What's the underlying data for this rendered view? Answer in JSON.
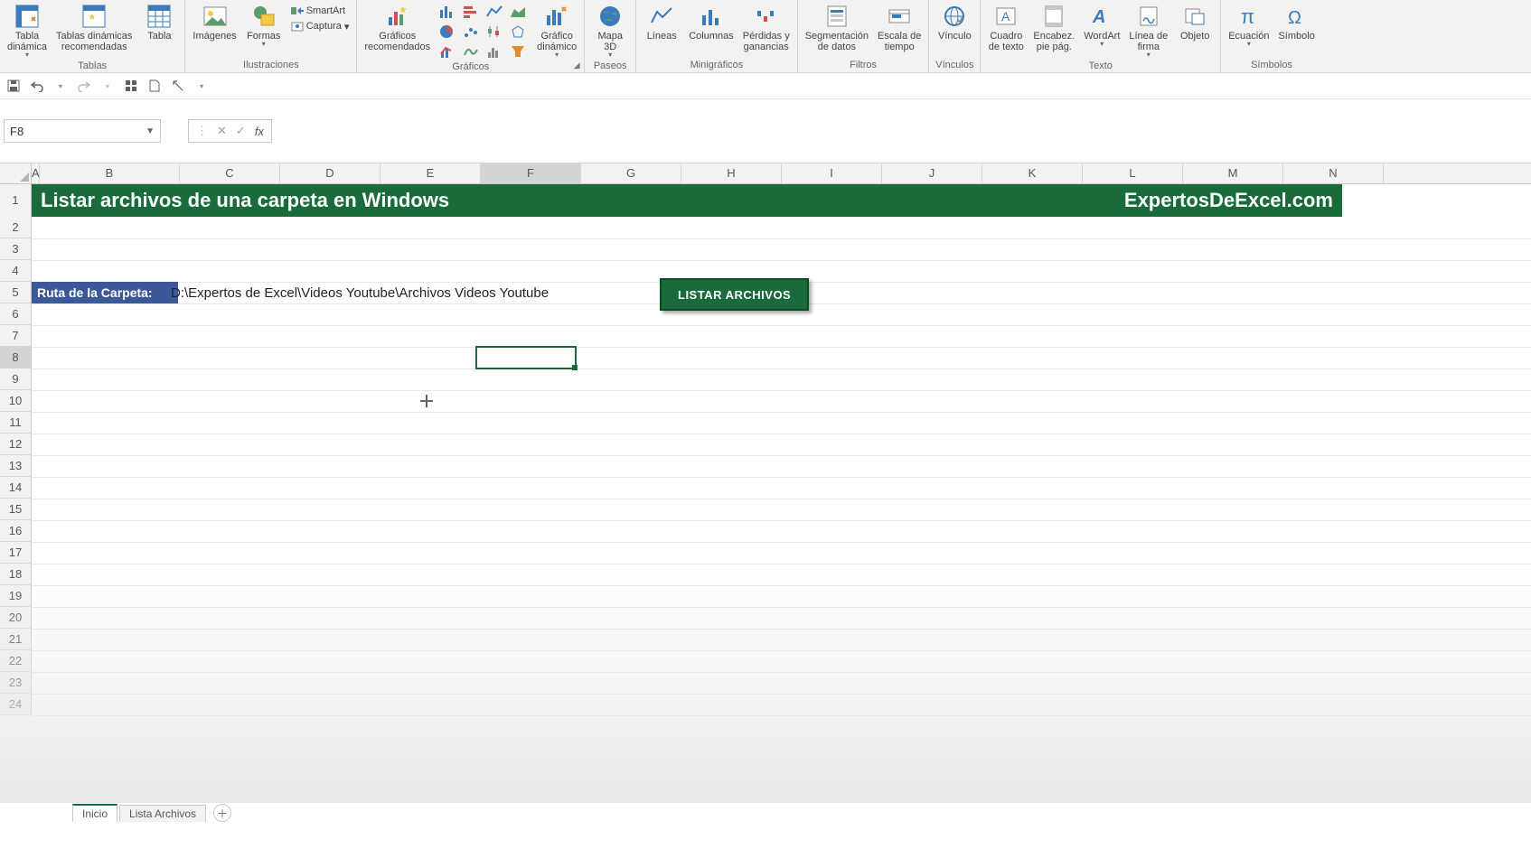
{
  "ribbon": {
    "groups": {
      "tablas": {
        "label": "Tablas",
        "pivot": "Tabla\ndinámica",
        "pivot_rec": "Tablas dinámicas\nrecomendadas",
        "table": "Tabla"
      },
      "ilustraciones": {
        "label": "Ilustraciones",
        "images": "Imágenes",
        "shapes": "Formas",
        "smartart": "SmartArt",
        "capture": "Captura"
      },
      "graficos": {
        "label": "Gráficos",
        "rec": "Gráficos\nrecomendados",
        "dynamic": "Gráfico\ndinámico"
      },
      "paseos": {
        "label": "Paseos",
        "map3d": "Mapa\n3D"
      },
      "mini": {
        "label": "Minigráficos",
        "lines": "Líneas",
        "cols": "Columnas",
        "winloss": "Pérdidas y\nganancias"
      },
      "filtros": {
        "label": "Filtros",
        "slicer": "Segmentación\nde datos",
        "timeline": "Escala de\ntiempo"
      },
      "vinculos": {
        "label": "Vínculos",
        "link": "Vínculo"
      },
      "texto": {
        "label": "Texto",
        "textbox": "Cuadro\nde texto",
        "header": "Encabez.\npie pág.",
        "wordart": "WordArt",
        "sig": "Línea de\nfirma",
        "obj": "Objeto"
      },
      "simbolos": {
        "label": "Símbolos",
        "eq": "Ecuación",
        "sym": "Símbolo"
      }
    }
  },
  "name_box": "F8",
  "formula_bar": "",
  "columns": [
    "A",
    "B",
    "C",
    "D",
    "E",
    "F",
    "G",
    "H",
    "I",
    "J",
    "K",
    "L",
    "M",
    "N"
  ],
  "col_widths": {
    "A": 8,
    "B": 154,
    "C": 110,
    "D": 110,
    "E": 110,
    "F": 110,
    "G": 110,
    "H": 110,
    "I": 110,
    "J": 110,
    "K": 110,
    "L": 110,
    "M": 110,
    "N": 110
  },
  "active_col": "F",
  "active_row": 8,
  "row_count": 24,
  "title_left": "Listar archivos de una carpeta en Windows",
  "title_right": "ExpertosDeExcel.com",
  "folder_label": "Ruta de la Carpeta:",
  "folder_path": "D:\\Expertos de Excel\\Videos Youtube\\Archivos Videos Youtube",
  "action_button": "LISTAR ARCHIVOS",
  "sheet_tabs": {
    "active": "Inicio",
    "other": "Lista Archivos"
  },
  "chart_data": null
}
